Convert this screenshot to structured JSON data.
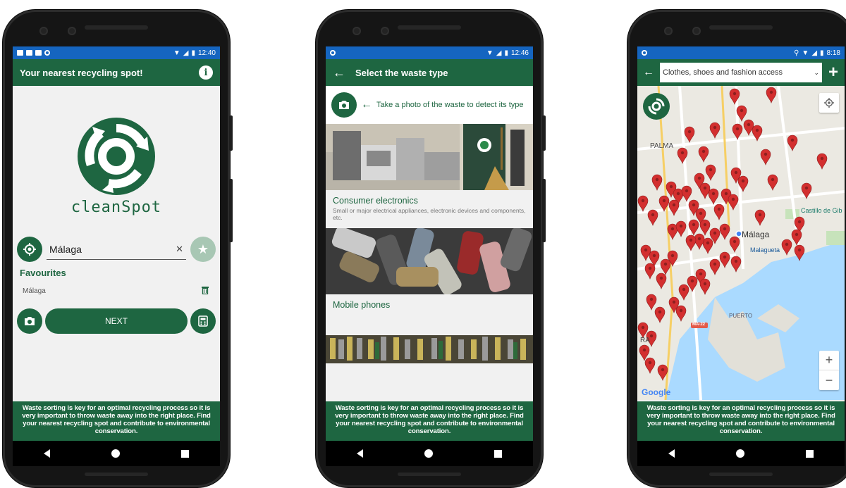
{
  "colors": {
    "brand_green": "#1e6641",
    "status_blue": "#1565c0",
    "pin_red": "#d32f2f",
    "sea_blue": "#aadaff"
  },
  "screens": [
    {
      "status": {
        "time": "12:40"
      },
      "appbar": {
        "title": "Your nearest recycling spot!",
        "icon": "info-icon"
      },
      "brand": "cleanSpot",
      "search": {
        "value": "Málaga"
      },
      "favourites": {
        "title": "Favourites",
        "items": [
          "Málaga"
        ]
      },
      "next_label": "NEXT",
      "footer": "Waste sorting is key for an optimal recycling process so it is very important to throw waste away into the right place. Find your nearest recycling spot and contribute to environmental conservation."
    },
    {
      "status": {
        "time": "12:46"
      },
      "appbar": {
        "title": "Select the waste type"
      },
      "hint": "Take a photo of the waste to detect its type",
      "categories": [
        {
          "title": "Consumer electronics",
          "desc": "Small or major electrical appliances, electronic devices and components, etc."
        },
        {
          "title": "Mobile phones",
          "desc": ""
        }
      ],
      "footer": "Waste sorting is key for an optimal recycling process so it is very important to throw waste away into the right place. Find your nearest recycling spot and contribute to environmental conservation."
    },
    {
      "status": {
        "time": "8:18"
      },
      "selected_waste": "Clothes, shoes and fashion access",
      "map_labels": {
        "palma": "PALMA",
        "malaga": "Málaga",
        "malagueta": "Malagueta",
        "castillo": "Castillo de Gib",
        "puerto": "PUERTO",
        "road": "MA-22",
        "google": "Google",
        "ra": "RA"
      },
      "zoom": {
        "in": "+",
        "out": "−"
      },
      "footer": "Waste sorting is key for an optimal recycling process so it is very important to throw waste away into the right place. Find your nearest recycling spot and contribute to environmental conservation."
    }
  ]
}
